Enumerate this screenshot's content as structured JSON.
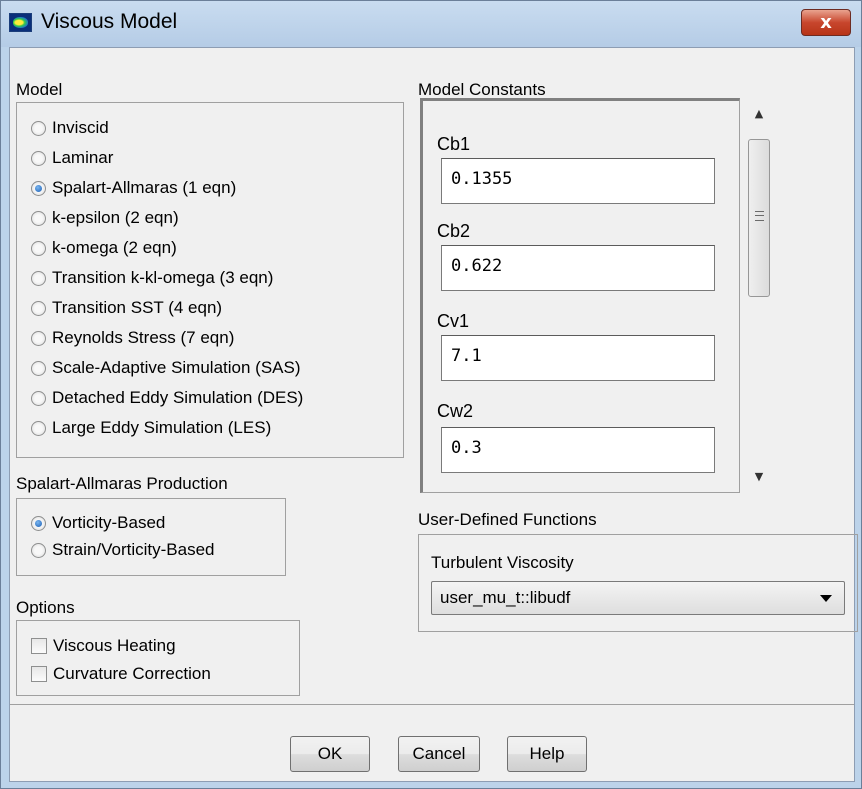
{
  "window": {
    "title": "Viscous Model",
    "close_label": "x"
  },
  "model": {
    "label": "Model",
    "options": [
      {
        "label": "Inviscid",
        "selected": false
      },
      {
        "label": "Laminar",
        "selected": false
      },
      {
        "label": "Spalart-Allmaras (1 eqn)",
        "selected": true
      },
      {
        "label": "k-epsilon (2 eqn)",
        "selected": false
      },
      {
        "label": "k-omega (2 eqn)",
        "selected": false
      },
      {
        "label": "Transition k-kl-omega (3 eqn)",
        "selected": false
      },
      {
        "label": "Transition SST (4 eqn)",
        "selected": false
      },
      {
        "label": "Reynolds Stress (7 eqn)",
        "selected": false
      },
      {
        "label": "Scale-Adaptive Simulation (SAS)",
        "selected": false
      },
      {
        "label": "Detached Eddy Simulation (DES)",
        "selected": false
      },
      {
        "label": "Large Eddy Simulation (LES)",
        "selected": false
      }
    ]
  },
  "production": {
    "label": "Spalart-Allmaras Production",
    "options": [
      {
        "label": "Vorticity-Based",
        "selected": true
      },
      {
        "label": "Strain/Vorticity-Based",
        "selected": false
      }
    ]
  },
  "options": {
    "label": "Options",
    "checks": [
      {
        "label": "Viscous Heating",
        "checked": false
      },
      {
        "label": "Curvature Correction",
        "checked": false
      }
    ]
  },
  "constants": {
    "label": "Model Constants",
    "items": [
      {
        "name": "Cb1",
        "value": "0.1355"
      },
      {
        "name": "Cb2",
        "value": "0.622"
      },
      {
        "name": "Cv1",
        "value": "7.1"
      },
      {
        "name": "Cw2",
        "value": "0.3"
      }
    ]
  },
  "udf": {
    "label": "User-Defined Functions",
    "turbulent_viscosity_label": "Turbulent Viscosity",
    "turbulent_viscosity_value": "user_mu_t::libudf"
  },
  "buttons": {
    "ok": "OK",
    "cancel": "Cancel",
    "help": "Help"
  }
}
